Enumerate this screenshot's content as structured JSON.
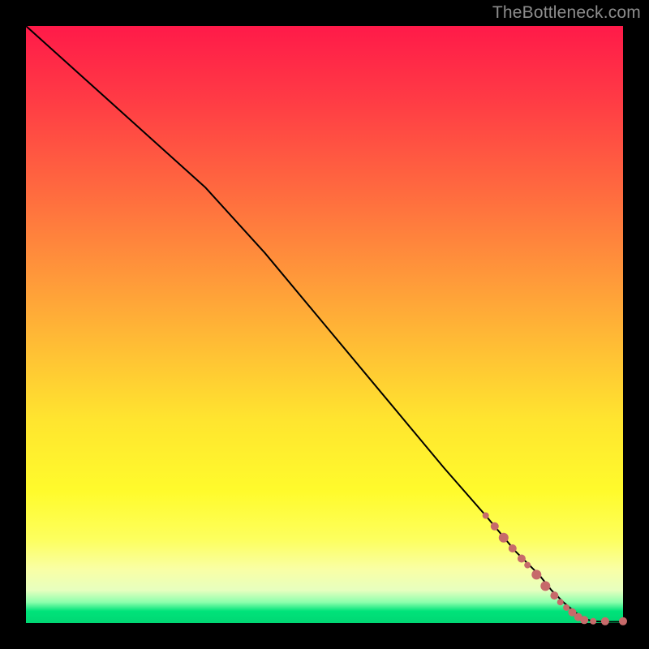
{
  "watermark": "TheBottleneck.com",
  "colors": {
    "marker": "#c76a6a",
    "line": "#000000"
  },
  "chart_data": {
    "type": "line",
    "title": "",
    "xlabel": "",
    "ylabel": "",
    "xlim": [
      0,
      100
    ],
    "ylim": [
      0,
      100
    ],
    "grid": false,
    "series": [
      {
        "name": "curve",
        "x": [
          0,
          10,
          20,
          30,
          40,
          50,
          60,
          70,
          77,
          82,
          86,
          88,
          90,
          92,
          93.5,
          95,
          97,
          100
        ],
        "y": [
          100,
          91,
          82,
          73,
          62,
          50,
          38,
          26,
          18,
          12,
          8,
          5.5,
          3.5,
          1.8,
          0.7,
          0.3,
          0.2,
          0.2
        ]
      }
    ],
    "markers": [
      {
        "x": 77,
        "y": 18,
        "r": 4
      },
      {
        "x": 78.5,
        "y": 16.2,
        "r": 5
      },
      {
        "x": 80,
        "y": 14.3,
        "r": 6
      },
      {
        "x": 81.5,
        "y": 12.5,
        "r": 5
      },
      {
        "x": 83,
        "y": 10.8,
        "r": 5
      },
      {
        "x": 84,
        "y": 9.7,
        "r": 4
      },
      {
        "x": 85.5,
        "y": 8.1,
        "r": 6
      },
      {
        "x": 87,
        "y": 6.2,
        "r": 6
      },
      {
        "x": 88.5,
        "y": 4.6,
        "r": 5
      },
      {
        "x": 89.5,
        "y": 3.5,
        "r": 4
      },
      {
        "x": 90.5,
        "y": 2.6,
        "r": 4
      },
      {
        "x": 91.5,
        "y": 1.8,
        "r": 5
      },
      {
        "x": 92.5,
        "y": 1.0,
        "r": 5
      },
      {
        "x": 93.5,
        "y": 0.5,
        "r": 5
      },
      {
        "x": 95,
        "y": 0.3,
        "r": 4
      },
      {
        "x": 97,
        "y": 0.3,
        "r": 5
      },
      {
        "x": 100,
        "y": 0.3,
        "r": 5
      }
    ]
  }
}
